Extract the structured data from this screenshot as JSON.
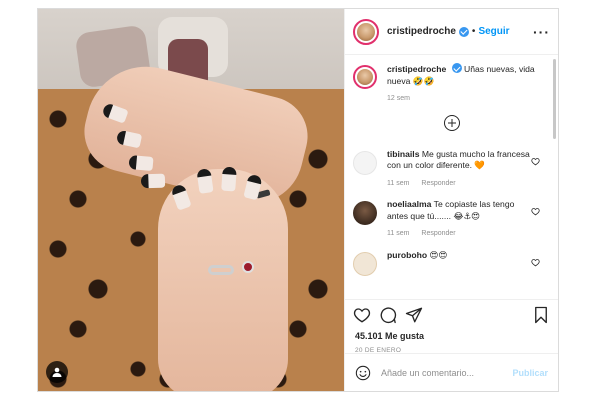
{
  "post": {
    "username": "cristipedroche",
    "follow_label": "Seguir",
    "dot": "•",
    "more_label": "···"
  },
  "caption": {
    "username": "cristipedroche",
    "text": "Uñas nuevas, vida nueva 🤣🤣",
    "time": "12 sem"
  },
  "comments": [
    {
      "username": "tibinails",
      "text": "Me gusta mucho la francesa con un color diferente. 🧡",
      "time": "11 sem",
      "reply_label": "Responder"
    },
    {
      "username": "noeliaalma",
      "text": "Te copiaste las tengo antes que tú....... 😂⚓😍",
      "time": "11 sem",
      "reply_label": "Responder"
    },
    {
      "username": "puroboho",
      "text": "😍😍",
      "time": "",
      "reply_label": ""
    }
  ],
  "likes_text": "45.101 Me gusta",
  "date_text": "20 DE ENERO",
  "add_comment": {
    "placeholder": "Añade un comentario...",
    "publish_label": "Publicar"
  },
  "colors": {
    "link_blue": "#0095f6",
    "verified_blue": "#3897f0",
    "publish_disabled": "#b2dffc",
    "meta_gray": "#8e8e8e"
  },
  "icons": [
    "heart-icon",
    "comment-icon",
    "share-icon",
    "bookmark-icon",
    "emoji-icon",
    "verified-icon",
    "user-tag-icon",
    "load-more-icon"
  ]
}
